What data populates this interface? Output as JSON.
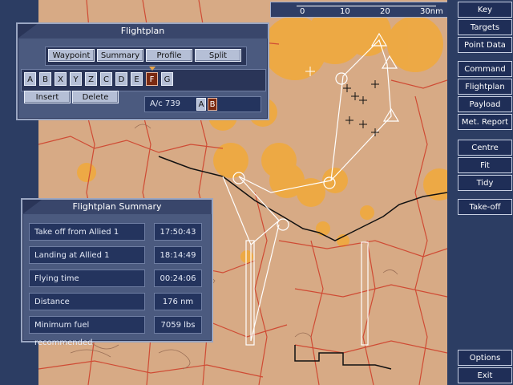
{
  "flightplan": {
    "title": "Flightplan",
    "tabs": [
      "Waypoint",
      "Summary",
      "Profile",
      "Split"
    ],
    "waypoint_keys": [
      "A",
      "B",
      "X",
      "Y",
      "Z",
      "C",
      "D",
      "E",
      "F",
      "G"
    ],
    "selected_waypoint": "F",
    "insert_label": "Insert",
    "delete_label": "Delete",
    "aircraft_label": "A/c 739",
    "aircraft_options": [
      "A",
      "B"
    ],
    "aircraft_selected": "B"
  },
  "summary": {
    "title": "Flightplan Summary",
    "rows": [
      {
        "label": "Take off from Allied 1",
        "value": "17:50:43"
      },
      {
        "label": "Landing at Allied 1",
        "value": "18:14:49"
      },
      {
        "label": "Flying time",
        "value": "00:24:06"
      },
      {
        "label": "Distance",
        "value": "176 nm"
      },
      {
        "label": "Minimum fuel recommended",
        "value": "7059 lbs"
      }
    ]
  },
  "sidebar": {
    "group1": [
      "Key",
      "Targets",
      "Point Data"
    ],
    "group2": [
      "Command",
      "Flightplan",
      "Payload",
      "Met. Report"
    ],
    "group3": [
      "Centre",
      "Fit",
      "Tidy"
    ],
    "group4": [
      "Take-off"
    ],
    "group5": [
      "Options",
      "Exit"
    ]
  },
  "scale": {
    "ticks": [
      "0",
      "10",
      "20",
      "30nm"
    ]
  },
  "map": {
    "waypoints": [
      "A",
      "B",
      "C",
      "D",
      "E",
      "F",
      "G"
    ],
    "colors": {
      "land": "#d7aa85",
      "threat": "#f0a93e",
      "border": "#cf4b34",
      "route": "#ffffff",
      "road": "#101010"
    }
  }
}
